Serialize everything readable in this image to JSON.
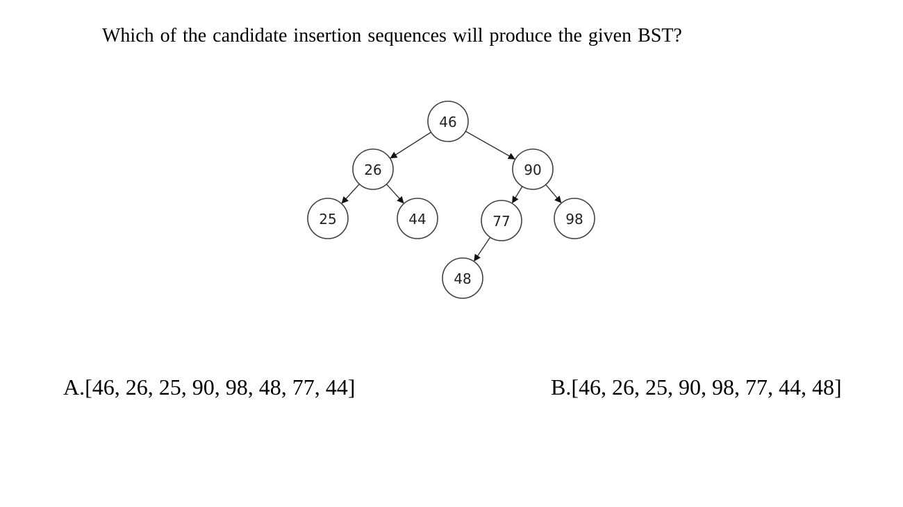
{
  "question": "Which of the candidate insertion sequences will produce the given BST?",
  "tree": {
    "nodes": [
      {
        "id": "n46",
        "label": "46"
      },
      {
        "id": "n26",
        "label": "26"
      },
      {
        "id": "n90",
        "label": "90"
      },
      {
        "id": "n25",
        "label": "25"
      },
      {
        "id": "n44",
        "label": "44"
      },
      {
        "id": "n77",
        "label": "77"
      },
      {
        "id": "n98",
        "label": "98"
      },
      {
        "id": "n48",
        "label": "48"
      }
    ],
    "edges": [
      {
        "from": "n46",
        "to": "n26"
      },
      {
        "from": "n46",
        "to": "n90"
      },
      {
        "from": "n26",
        "to": "n25"
      },
      {
        "from": "n26",
        "to": "n44"
      },
      {
        "from": "n90",
        "to": "n77"
      },
      {
        "from": "n90",
        "to": "n98"
      },
      {
        "from": "n77",
        "to": "n48"
      }
    ]
  },
  "options": {
    "a": "A.[46, 26, 25, 90, 98, 48, 77, 44]",
    "b": "B.[46, 26, 25, 90, 98, 77, 44, 48]"
  }
}
